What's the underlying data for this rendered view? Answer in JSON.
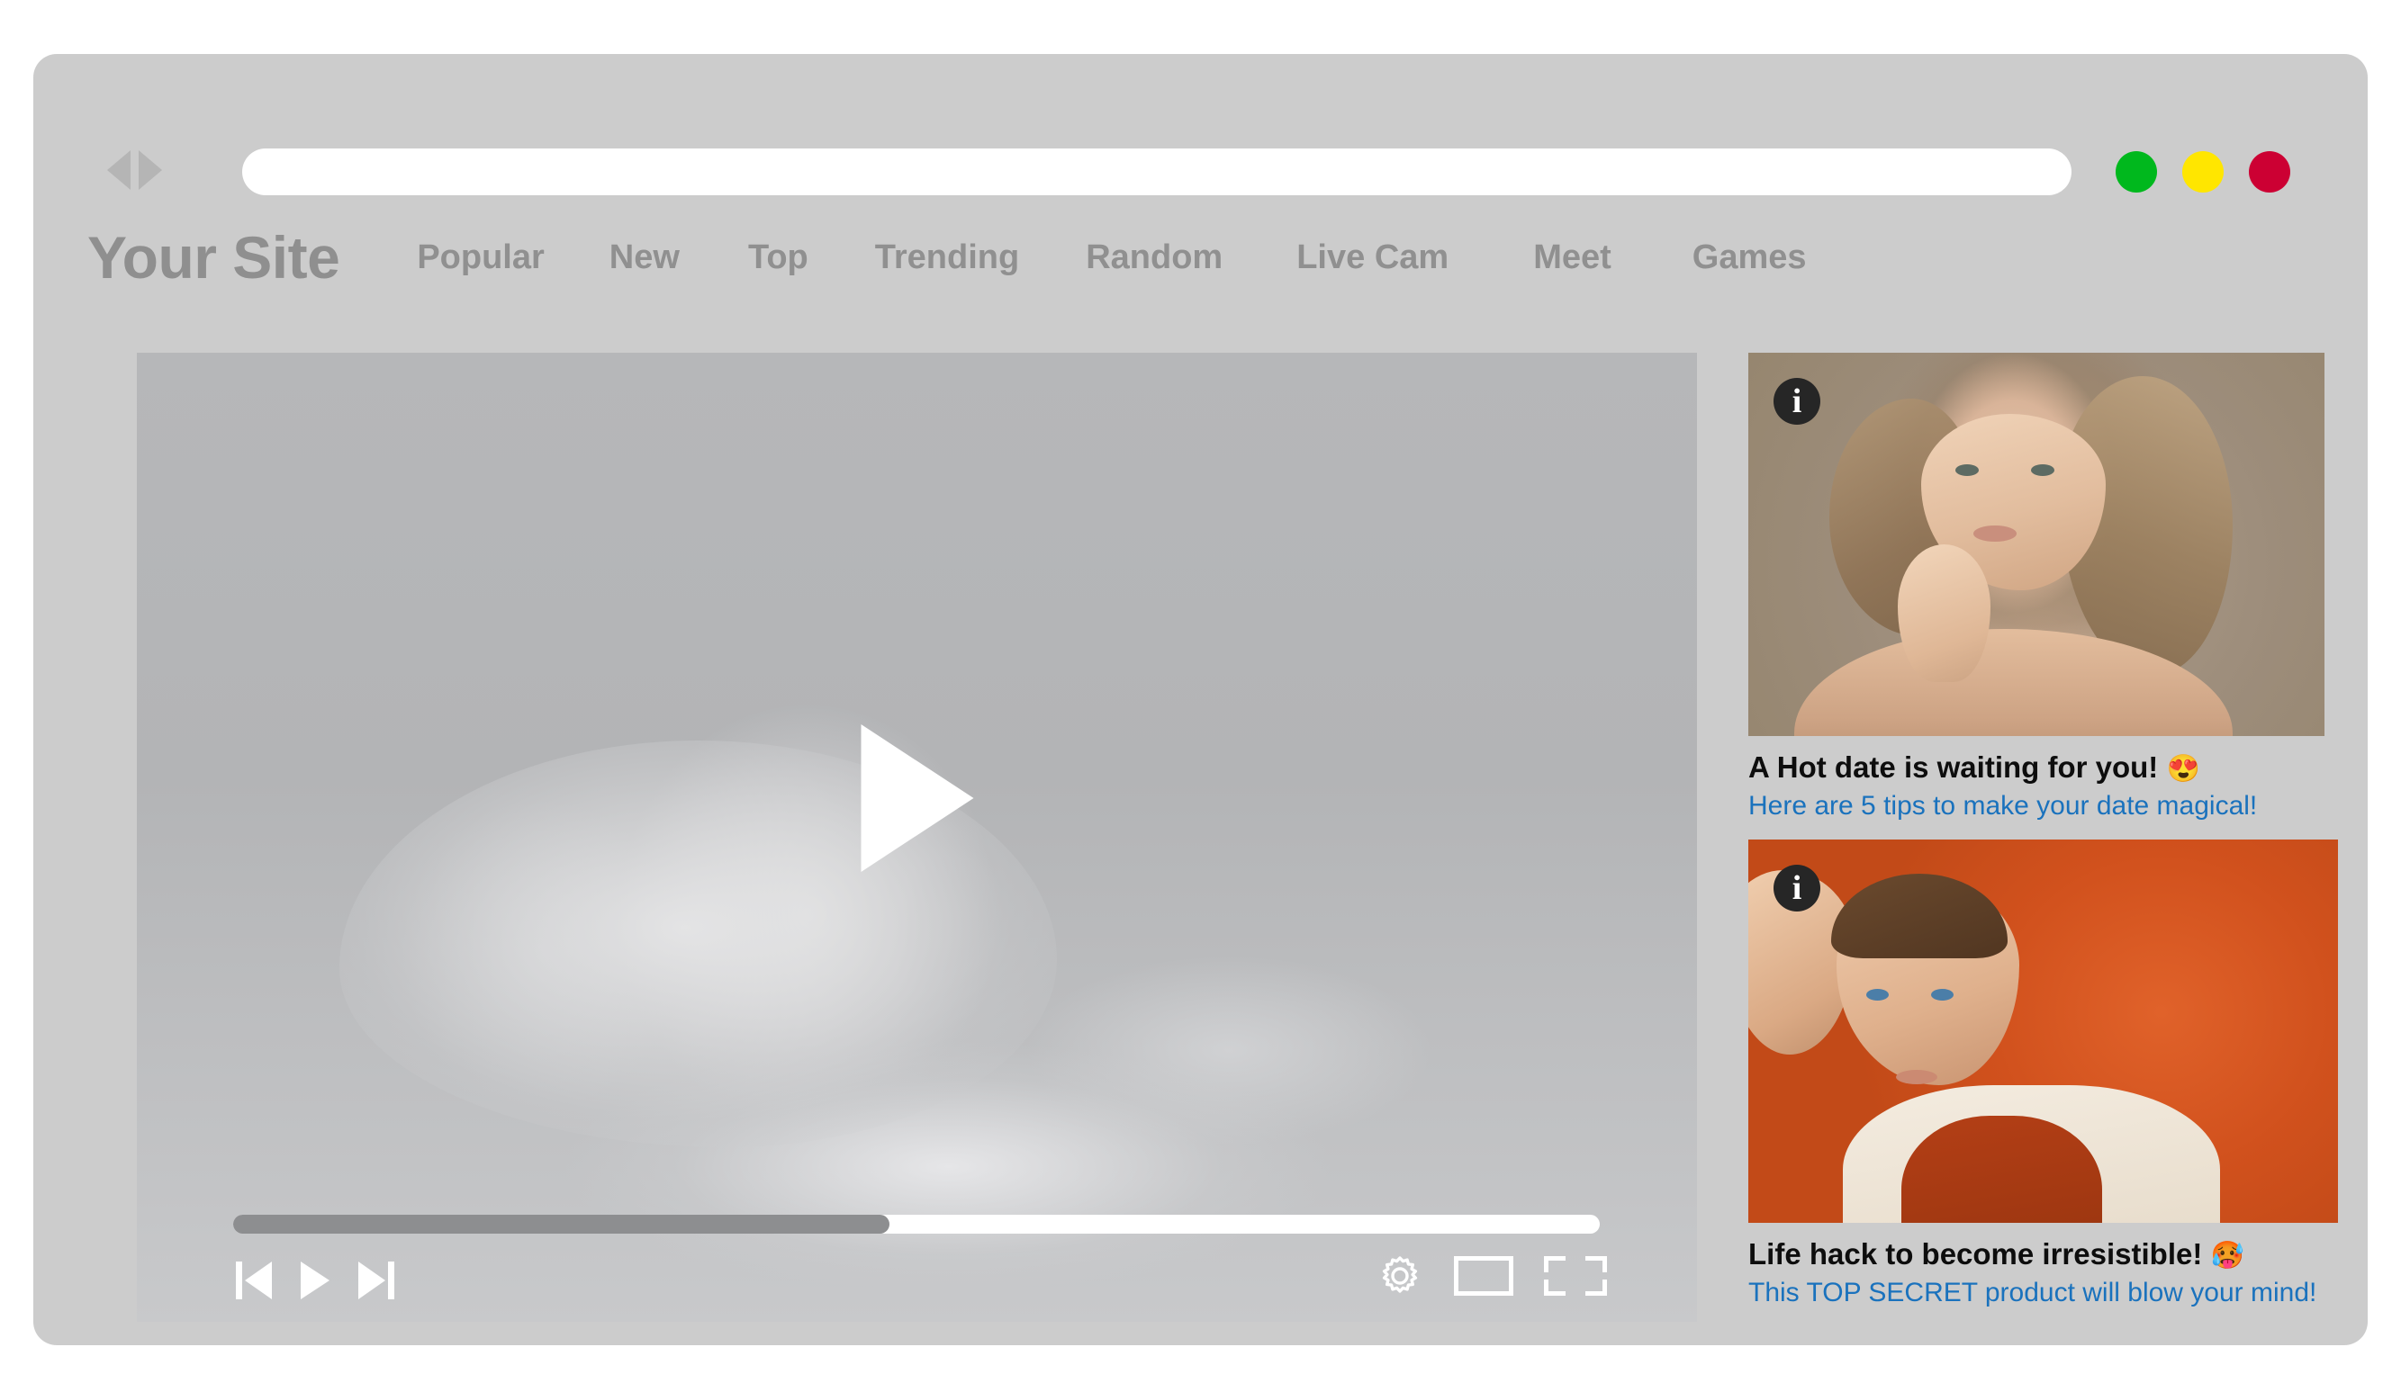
{
  "browser": {
    "back_icon": "triangle-left-icon",
    "forward_icon": "triangle-right-icon",
    "url_value": "",
    "url_placeholder": "",
    "dots": [
      {
        "name": "minimize",
        "color": "#00b81d"
      },
      {
        "name": "maximize",
        "color": "#ffe600"
      },
      {
        "name": "close",
        "color": "#cc0033"
      }
    ]
  },
  "header": {
    "logo": "Your Site",
    "nav": [
      {
        "label": "Popular"
      },
      {
        "label": "New"
      },
      {
        "label": "Top"
      },
      {
        "label": "Trending"
      },
      {
        "label": "Random"
      },
      {
        "label": "Live Cam"
      },
      {
        "label": "Meet"
      },
      {
        "label": "Games"
      }
    ]
  },
  "player": {
    "big_play_icon": "play-triangle-icon",
    "progress_percent": 48,
    "controls_left": [
      {
        "icon": "previous-track-icon"
      },
      {
        "icon": "play-icon"
      },
      {
        "icon": "next-track-icon"
      }
    ],
    "controls_right": [
      {
        "icon": "settings-gear-icon"
      },
      {
        "icon": "theater-mode-icon"
      },
      {
        "icon": "fullscreen-icon"
      }
    ]
  },
  "sidebar": {
    "ads": [
      {
        "info_badge": "i",
        "image_alt": "woman-portrait",
        "title": "A Hot date is waiting for you!",
        "emoji": "😍",
        "subtitle": "Here are 5 tips to make your date magical!"
      },
      {
        "info_badge": "i",
        "image_alt": "man-portrait",
        "title": "Life hack to become irresistible!",
        "emoji": "🥵",
        "subtitle": "This TOP SECRET product will blow your mind!"
      }
    ]
  },
  "colors": {
    "window_chrome": "#cccccc",
    "video_bg": "#b2b3b5",
    "link_blue": "#1a72bd",
    "nav_gray": "#909090"
  }
}
